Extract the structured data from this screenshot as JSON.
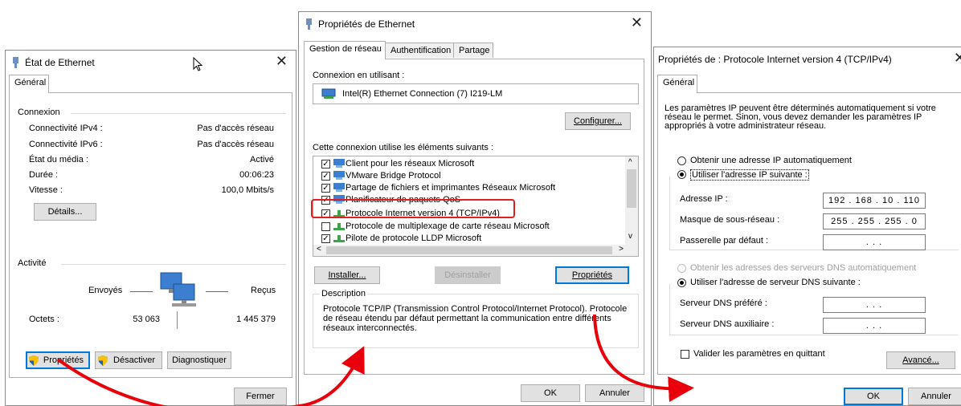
{
  "colors": {
    "accent": "#0078d7",
    "highlight": "#e02020",
    "arrow": "#e8000b",
    "shield_blue": "#1c5fb5",
    "shield_yellow": "#f4c20d",
    "net_green": "#3fa34d"
  },
  "w1": {
    "title": "État de Ethernet",
    "tab": "Général",
    "connexion_label": "Connexion",
    "rows": [
      {
        "label": "Connectivité IPv4 :",
        "value": "Pas d'accès réseau"
      },
      {
        "label": "Connectivité IPv6 :",
        "value": "Pas d'accès réseau"
      },
      {
        "label": "État du média :",
        "value": "Activé"
      },
      {
        "label": "Durée :",
        "value": "00:06:23"
      },
      {
        "label": "Vitesse :",
        "value": "100,0 Mbits/s"
      }
    ],
    "details_btn": "Détails...",
    "activite_label": "Activité",
    "sent_label": "Envoyés",
    "recv_label": "Reçus",
    "octets_label": "Octets :",
    "octets_sent": "53 063",
    "octets_recv": "1 445 379",
    "btn_props": "Propriétés",
    "btn_disable": "Désactiver",
    "btn_diag": "Diagnostiquer",
    "btn_close": "Fermer"
  },
  "w2": {
    "title": "Propriétés de Ethernet",
    "tabs": [
      "Gestion de réseau",
      "Authentification",
      "Partage"
    ],
    "connect_using": "Connexion en utilisant :",
    "adapter": "Intel(R) Ethernet Connection (7) I219-LM",
    "configure_btn": "Configurer...",
    "items_label": "Cette connexion utilise les éléments suivants :",
    "items": [
      {
        "label": "Client pour les réseaux Microsoft",
        "checked": true
      },
      {
        "label": "VMware Bridge Protocol",
        "checked": true
      },
      {
        "label": "Partage de fichiers et imprimantes Réseaux Microsoft",
        "checked": true
      },
      {
        "label": "Planificateur de paquets QoS",
        "checked": true
      },
      {
        "label": "Protocole Internet version 4 (TCP/IPv4)",
        "checked": true
      },
      {
        "label": "Protocole de multiplexage de carte réseau Microsoft",
        "checked": false
      },
      {
        "label": "Pilote de protocole LLDP Microsoft",
        "checked": true
      }
    ],
    "install_btn": "Installer...",
    "uninstall_btn": "Désinstaller",
    "props_btn": "Propriétés",
    "desc_label": "Description",
    "desc_text": "Protocole TCP/IP (Transmission Control Protocol/Internet Protocol). Protocole de réseau étendu par défaut permettant la communication entre différents réseaux interconnectés.",
    "ok_btn": "OK",
    "cancel_btn": "Annuler"
  },
  "w3": {
    "title": "Propriétés de : Protocole Internet version 4 (TCP/IPv4)",
    "tab": "Général",
    "intro": "Les paramètres IP peuvent être déterminés automatiquement si votre réseau le permet. Sinon, vous devez demander les paramètres IP appropriés à votre administrateur réseau.",
    "radio_auto_ip": "Obtenir une adresse IP automatiquement",
    "radio_manual_ip": "Utiliser l'adresse IP suivante :",
    "ip_label": "Adresse IP :",
    "ip_value": "192 . 168 . 10 . 110",
    "mask_label": "Masque de sous-réseau :",
    "mask_value": "255 . 255 . 255 . 0",
    "gw_label": "Passerelle par défaut :",
    "gw_value": ".       .       .",
    "radio_auto_dns": "Obtenir les adresses des serveurs DNS automatiquement",
    "radio_manual_dns": "Utiliser l'adresse de serveur DNS suivante :",
    "dns1_label": "Serveur DNS préféré :",
    "dns1_value": ".       .       .",
    "dns2_label": "Serveur DNS auxiliaire :",
    "dns2_value": ".       .       .",
    "validate_label": "Valider les paramètres en quittant",
    "advanced_btn": "Avancé...",
    "ok_btn": "OK",
    "cancel_btn": "Annuler"
  }
}
